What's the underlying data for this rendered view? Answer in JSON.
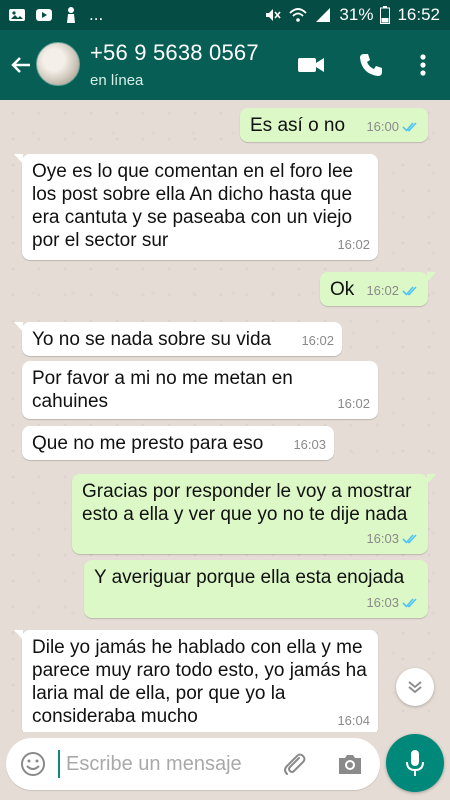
{
  "status_bar": {
    "battery": "31%",
    "time": "16:52",
    "more": "..."
  },
  "header": {
    "contact_name": "+56 9 5638 0567",
    "status": "en línea"
  },
  "messages": [
    {
      "dir": "out",
      "text": "Es así o no",
      "time": "16:00",
      "read": true
    },
    {
      "dir": "in",
      "text": "Oye es lo que comentan en el foro lee los post sobre ella An dicho hasta que era cantuta y se paseaba con un viejo por el sector sur",
      "time": "16:02"
    },
    {
      "dir": "out",
      "text": "Ok",
      "time": "16:02",
      "read": true
    },
    {
      "dir": "in",
      "text": "Yo no se nada sobre su vida",
      "time": "16:02"
    },
    {
      "dir": "in",
      "text": "Por favor a mi no me metan en cahuines",
      "time": "16:02"
    },
    {
      "dir": "in",
      "text": "Que no me presto para eso",
      "time": "16:03"
    },
    {
      "dir": "out",
      "text": "Gracias por responder le voy a mostrar esto a ella y ver que yo no te dije nada",
      "time": "16:03",
      "read": true
    },
    {
      "dir": "out",
      "text": "Y averiguar porque ella esta enojada",
      "time": "16:03",
      "read": true
    },
    {
      "dir": "in",
      "text": "Dile yo jamás he hablado con ella y me parece muy raro todo esto, yo jamás ha laria mal de ella, por que yo la consideraba mucho",
      "time": "16:04"
    }
  ],
  "composer": {
    "placeholder": "Escribe un mensaje"
  },
  "colors": {
    "header": "#075e54",
    "statusbar": "#054d44",
    "outgoing_bubble": "#dcf8c6",
    "incoming_bubble": "#ffffff",
    "read_ticks": "#4fc3f7",
    "mic_button": "#00897b"
  }
}
